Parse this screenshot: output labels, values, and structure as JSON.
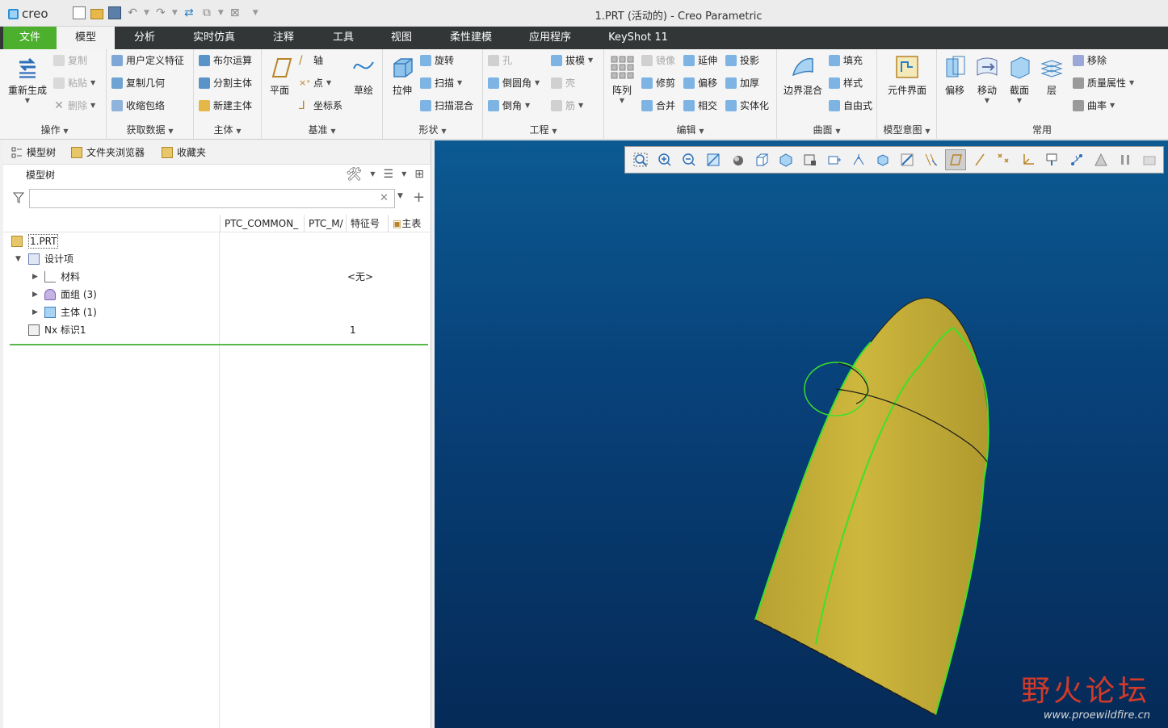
{
  "app": {
    "logo": "creo",
    "window_title": "1.PRT (活动的) - Creo Parametric"
  },
  "tabs": [
    {
      "label": "文件"
    },
    {
      "label": "模型"
    },
    {
      "label": "分析"
    },
    {
      "label": "实时仿真"
    },
    {
      "label": "注释"
    },
    {
      "label": "工具"
    },
    {
      "label": "视图"
    },
    {
      "label": "柔性建模"
    },
    {
      "label": "应用程序"
    },
    {
      "label": "KeyShot 11"
    }
  ],
  "ribbon": {
    "operations": {
      "name": "操作",
      "regen": "重新生成",
      "copy": "复制",
      "paste": "粘贴",
      "delete": "删除"
    },
    "get_data": {
      "name": "获取数据",
      "udf": "用户定义特征",
      "copy_geom": "复制几何",
      "shrinkwrap": "收缩包络"
    },
    "body": {
      "name": "主体",
      "boolean": "布尔运算",
      "split_body": "分割主体",
      "new_body": "新建主体"
    },
    "datum": {
      "name": "基准",
      "plane": "平面",
      "axis": "轴",
      "point": "点",
      "csys": "坐标系",
      "sketch": "草绘"
    },
    "shapes": {
      "name": "形状",
      "extrude": "拉伸",
      "revolve": "旋转",
      "sweep": "扫描",
      "swept_blend": "扫描混合"
    },
    "engineering": {
      "name": "工程",
      "hole": "孔",
      "round": "倒圆角",
      "chamfer": "倒角",
      "draft": "拔模",
      "shell": "壳",
      "rib": "筋"
    },
    "editing": {
      "name": "编辑",
      "pattern": "阵列",
      "mirror": "镜像",
      "trim": "修剪",
      "merge": "合并",
      "extend": "延伸",
      "offset": "偏移",
      "intersect": "相交",
      "project": "投影",
      "thicken": "加厚",
      "solidify": "实体化"
    },
    "surfaces": {
      "name": "曲面",
      "boundary_blend": "边界混合",
      "fill": "填充",
      "style": "样式",
      "freestyle": "自由式"
    },
    "model_intent": {
      "name": "模型意图",
      "component_interface": "元件界面"
    },
    "common": {
      "name": "常用",
      "offset": "偏移",
      "move": "移动",
      "section": "截面",
      "layer": "层",
      "remove": "移除",
      "mass_props": "质量属性",
      "curvature": "曲率"
    }
  },
  "navigator": {
    "tabs": [
      {
        "label": "模型树"
      },
      {
        "label": "文件夹浏览器"
      },
      {
        "label": "收藏夹"
      }
    ],
    "tree_header": "模型树",
    "search": {
      "value": "",
      "placeholder": ""
    },
    "columns": [
      {
        "label": "PTC_COMMON_"
      },
      {
        "label": "PTC_M/"
      },
      {
        "label": "特征号"
      },
      {
        "label": "主表"
      }
    ],
    "rows": [
      {
        "label": "1.PRT",
        "value": ""
      },
      {
        "label": "设计项",
        "value": ""
      },
      {
        "label": "材料",
        "value": "<无>"
      },
      {
        "label": "面组 (3)",
        "value": ""
      },
      {
        "label": "主体 (1)",
        "value": ""
      },
      {
        "label": "Nx 标识1",
        "value": "1"
      }
    ]
  },
  "watermark": {
    "line1": "野火论坛",
    "line2": "www.proewildfire.cn"
  },
  "colors": {
    "file_tab": "#4caf2e",
    "model_surface": "#c9b23a",
    "edge_highlight": "#3ee02a",
    "viewport_top": "#0c5a92",
    "viewport_bottom": "#052a57"
  }
}
